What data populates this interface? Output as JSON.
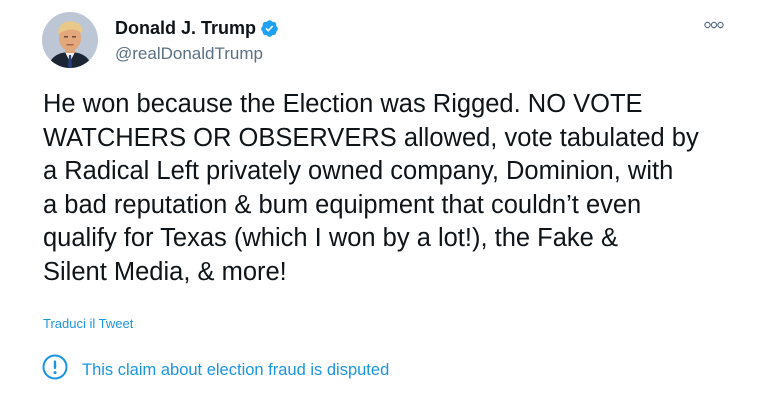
{
  "author": {
    "display_name": "Donald J. Trump",
    "handle": "@realDonaldTrump",
    "verified": true
  },
  "tweet": {
    "text": "He won because the Election was Rigged. NO VOTE\nWATCHERS OR OBSERVERS allowed, vote tabulated by\na Radical Left privately owned company, Dominion, with\na bad reputation & bum equipment that couldn’t even\nqualify for Texas (which I won by a lot!), the Fake &\nSilent Media, & more!",
    "translate_label": "Traduci il Tweet",
    "notice_label": "This claim about election fraud is disputed"
  },
  "icons": {
    "more": "more-options-icon",
    "verified": "verified-badge-icon",
    "notice": "exclamation-circle-icon"
  },
  "colors": {
    "link": "#1b95e0",
    "verified": "#1da1f2",
    "secondary_text": "#5b7083",
    "primary_text": "#0f1419"
  }
}
